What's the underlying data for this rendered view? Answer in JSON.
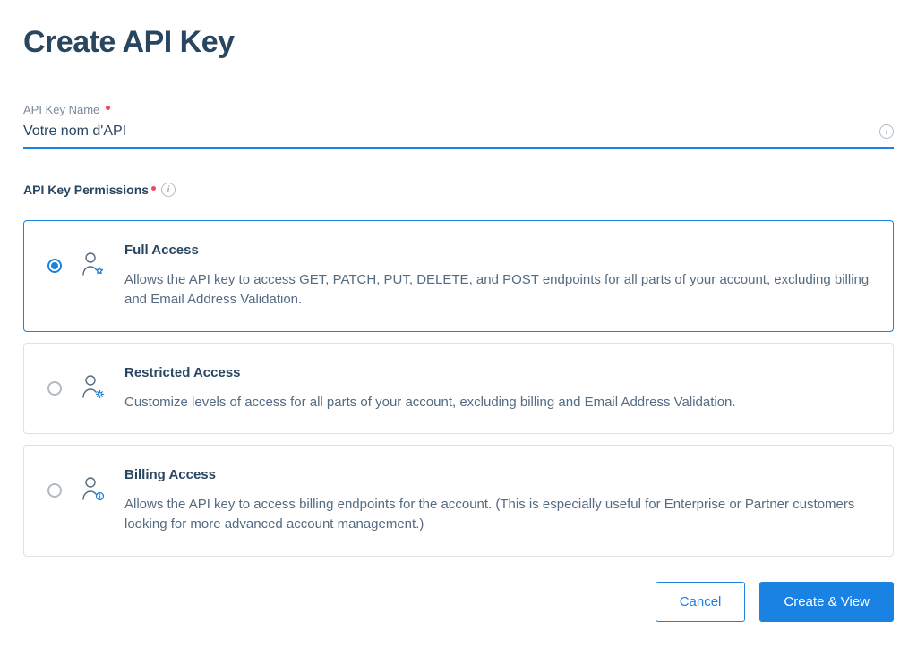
{
  "page_title": "Create API Key",
  "name_field": {
    "label": "API Key Name",
    "value": "Votre nom d'API"
  },
  "permissions_label": "API Key Permissions",
  "permissions": [
    {
      "title": "Full Access",
      "description": "Allows the API key to access GET, PATCH, PUT, DELETE, and POST endpoints for all parts of your account, excluding billing and Email Address Validation.",
      "selected": true
    },
    {
      "title": "Restricted Access",
      "description": "Customize levels of access for all parts of your account, excluding billing and Email Address Validation.",
      "selected": false
    },
    {
      "title": "Billing Access",
      "description": "Allows the API key to access billing endpoints for the account. (This is especially useful for Enterprise or Partner customers looking for more advanced account management.)",
      "selected": false
    }
  ],
  "buttons": {
    "cancel": "Cancel",
    "submit": "Create & View"
  }
}
